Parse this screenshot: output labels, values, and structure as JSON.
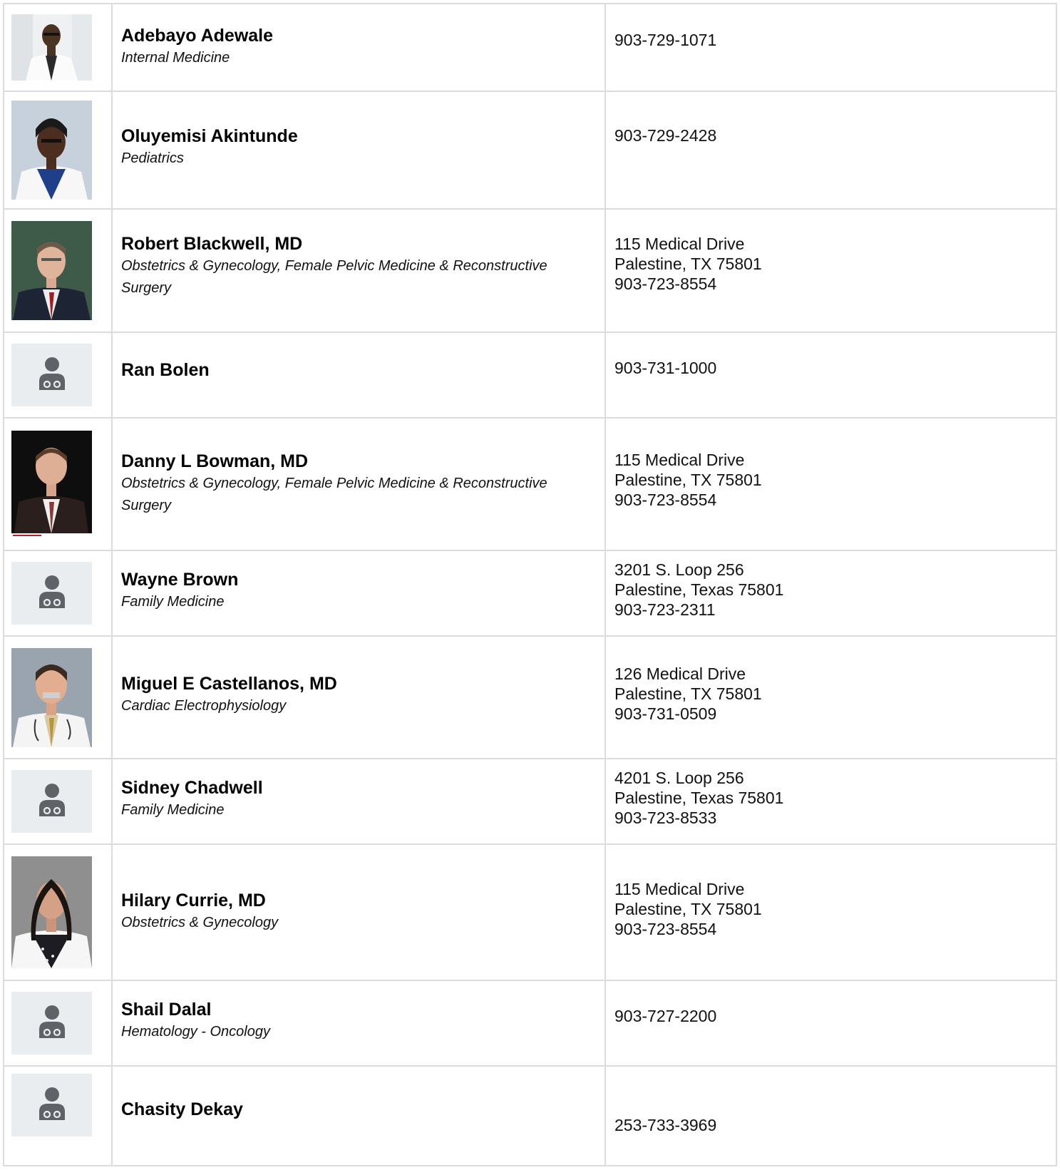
{
  "providers": [
    {
      "name": "Adebayo Adewale",
      "specialty": "Internal Medicine",
      "address1": "",
      "address2": "",
      "phone": "903-729-1071",
      "photo": "photo-adewale"
    },
    {
      "name": "Oluyemisi Akintunde",
      "specialty": "Pediatrics",
      "address1": "",
      "address2": "",
      "phone": "903-729-2428",
      "photo": "photo-akintunde"
    },
    {
      "name": "Robert Blackwell, MD",
      "specialty": "Obstetrics & Gynecology, Female Pelvic Medicine & Reconstructive Surgery",
      "address1": "115 Medical Drive",
      "address2": "Palestine, TX 75801",
      "phone": "903-723-8554",
      "photo": "photo-blackwell"
    },
    {
      "name": "Ran Bolen",
      "specialty": "",
      "address1": "",
      "address2": "",
      "phone": "903-731-1000",
      "photo": "doctor-placeholder-icon"
    },
    {
      "name": "Danny L Bowman, MD",
      "specialty": "Obstetrics & Gynecology, Female Pelvic Medicine & Reconstructive Surgery",
      "address1": "115 Medical Drive",
      "address2": "Palestine, TX 75801",
      "phone": "903-723-8554",
      "photo": "photo-bowman"
    },
    {
      "name": "Wayne Brown",
      "specialty": "Family Medicine",
      "address1": "3201 S. Loop 256",
      "address2": "Palestine, Texas 75801",
      "phone": "903-723-2311",
      "photo": "doctor-placeholder-icon"
    },
    {
      "name": "Miguel E Castellanos, MD",
      "specialty": "Cardiac Electrophysiology",
      "address1": "126 Medical Drive",
      "address2": "Palestine, TX 75801",
      "phone": "903-731-0509",
      "photo": "photo-castellanos"
    },
    {
      "name": "Sidney Chadwell",
      "specialty": "Family Medicine",
      "address1": "4201 S. Loop 256",
      "address2": "Palestine, Texas 75801",
      "phone": "903-723-8533",
      "photo": "doctor-placeholder-icon"
    },
    {
      "name": "Hilary Currie, MD",
      "specialty": "Obstetrics & Gynecology",
      "address1": "115 Medical Drive",
      "address2": "Palestine, TX 75801",
      "phone": "903-723-8554",
      "photo": "photo-currie"
    },
    {
      "name": "Shail Dalal",
      "specialty": "Hematology - Oncology",
      "address1": "",
      "address2": "",
      "phone": "903-727-2200",
      "photo": "doctor-placeholder-icon"
    },
    {
      "name": "Chasity Dekay",
      "specialty": "",
      "address1": "",
      "address2": "",
      "phone": "253-733-3969",
      "photo": "doctor-placeholder-icon"
    }
  ],
  "colors": {
    "border": "#dcdcdc",
    "placeholder_bg": "#eaedf0",
    "placeholder_icon": "#5f6368"
  }
}
